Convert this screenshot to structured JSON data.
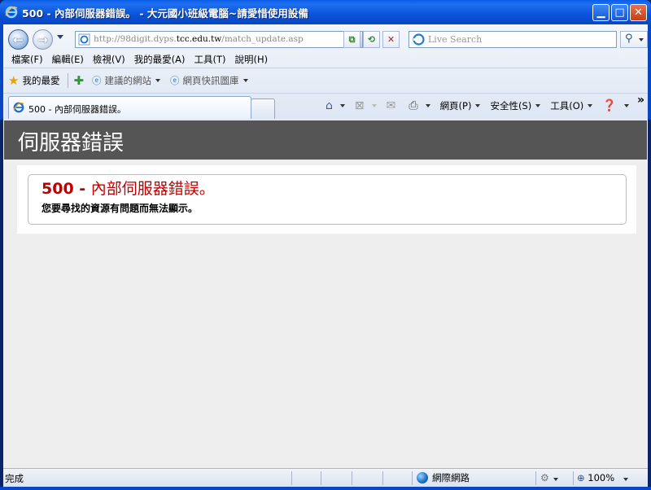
{
  "window": {
    "title": "500 - 內部伺服器錯誤。 - 大元國小班級電腦~請愛惜使用設備",
    "buttons": [
      "minimize",
      "maximize",
      "close"
    ]
  },
  "address_bar": {
    "url_prefix": "http://98digit.dyps.",
    "url_domain": "tcc.edu.tw",
    "url_suffix": "/match_update.asp"
  },
  "search": {
    "placeholder": "Live Search"
  },
  "menu": {
    "items": [
      "檔案(F)",
      "編輯(E)",
      "檢視(V)",
      "我的最愛(A)",
      "工具(T)",
      "說明(H)"
    ]
  },
  "favorites_bar": {
    "favorites_label": "我的最愛",
    "suggested_sites": "建議的網站",
    "web_slice_gallery": "網頁快訊圖庫"
  },
  "tabs": [
    {
      "label": "500 - 內部伺服器錯誤。",
      "active": true
    }
  ],
  "command_bar": {
    "page": "網頁(P)",
    "safety": "安全性(S)",
    "tools": "工具(O)",
    "overflow": "»"
  },
  "page": {
    "header": "伺服器錯誤",
    "error_code": "500 - ",
    "error_message": "內部伺服器錯誤。",
    "description": "您要尋找的資源有問題而無法顯示。"
  },
  "status_bar": {
    "status": "完成",
    "zone": "網際網路",
    "zoom": "100%"
  },
  "colors": {
    "titlebar": "#0a52d8",
    "header_bg": "#555555",
    "error_red": "#c00000",
    "content_bg": "#eeeeee"
  }
}
